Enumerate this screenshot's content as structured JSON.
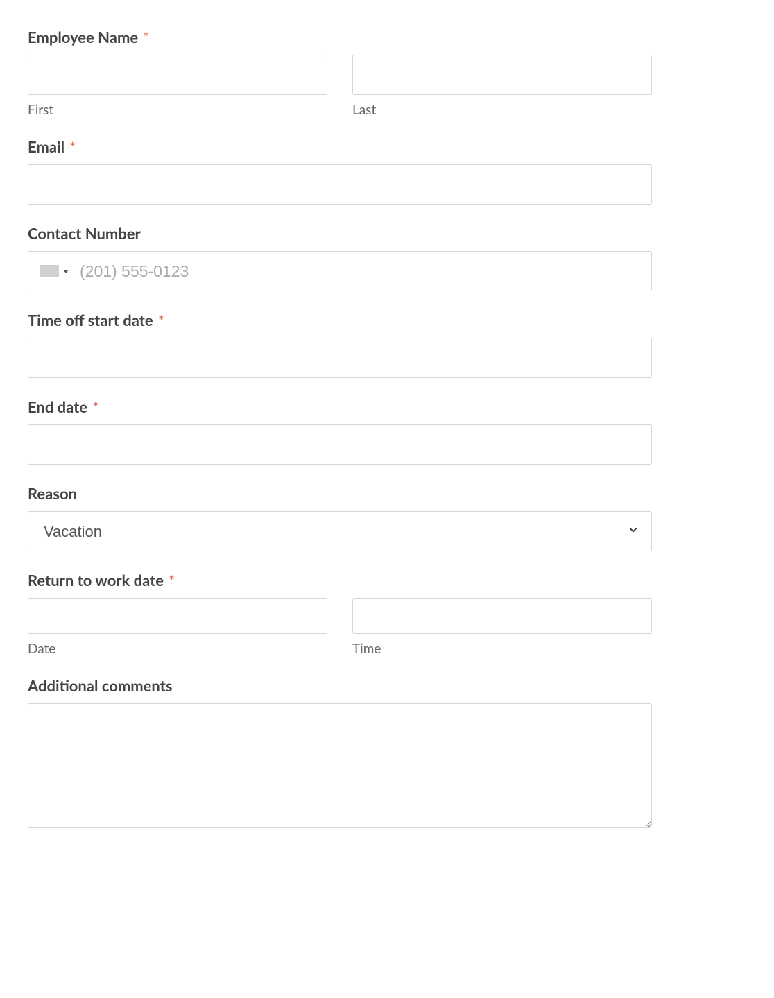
{
  "fields": {
    "employee_name": {
      "label": "Employee Name",
      "required": true,
      "first_sublabel": "First",
      "last_sublabel": "Last",
      "first_value": "",
      "last_value": ""
    },
    "email": {
      "label": "Email",
      "required": true,
      "value": ""
    },
    "contact_number": {
      "label": "Contact Number",
      "required": false,
      "placeholder": "(201) 555-0123",
      "value": ""
    },
    "start_date": {
      "label": "Time off start date",
      "required": true,
      "value": ""
    },
    "end_date": {
      "label": "End date",
      "required": true,
      "value": ""
    },
    "reason": {
      "label": "Reason",
      "required": false,
      "selected": "Vacation",
      "options": [
        "Vacation"
      ]
    },
    "return_to_work": {
      "label": "Return to work date",
      "required": true,
      "date_sublabel": "Date",
      "time_sublabel": "Time",
      "date_value": "",
      "time_value": ""
    },
    "comments": {
      "label": "Additional comments",
      "required": false,
      "value": ""
    }
  },
  "required_marker": "*"
}
